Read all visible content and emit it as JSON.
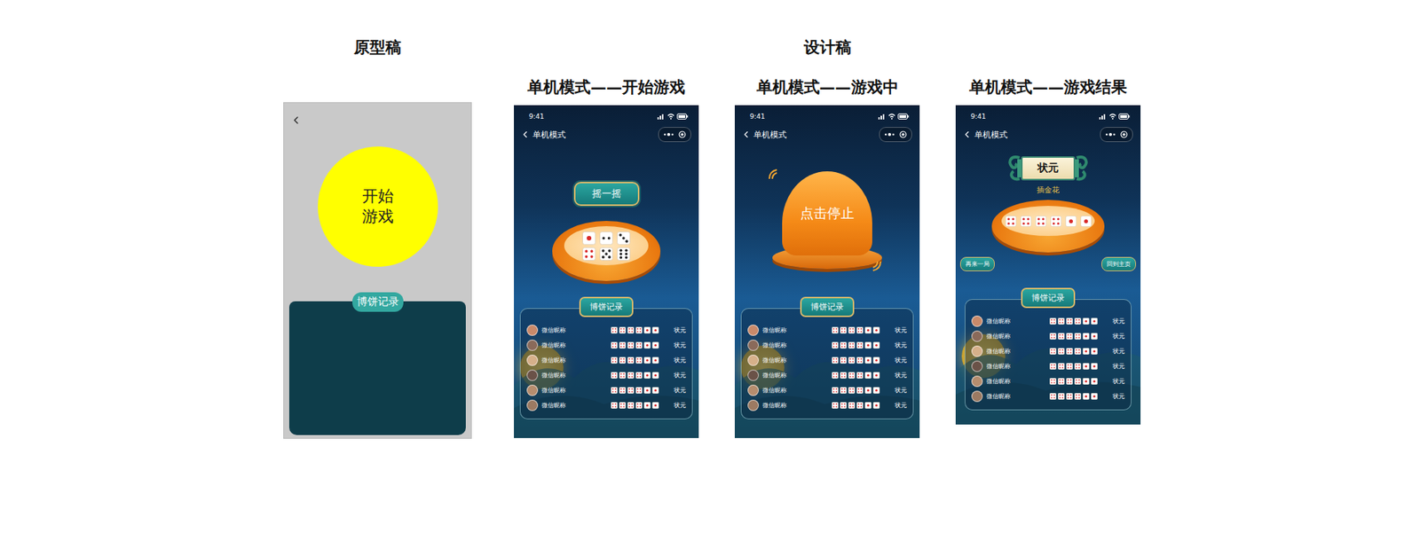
{
  "headings": {
    "prototype": "原型稿",
    "design": "设计稿"
  },
  "prototype": {
    "start_lines": [
      "开始",
      "游戏"
    ],
    "record_title": "博饼记录"
  },
  "screens": [
    {
      "kind": "start",
      "label": "单机模式——开始游戏",
      "time": "9:41",
      "nav_title": "单机模式",
      "badge": "摇一摇",
      "bowl_dice": [
        1,
        2,
        3,
        4,
        5,
        6
      ],
      "record_title": "博饼记录",
      "records": [
        {
          "name": "微信昵称",
          "dice": [
            4,
            4,
            4,
            4,
            1,
            1
          ],
          "result": "状元"
        },
        {
          "name": "微信昵称",
          "dice": [
            4,
            4,
            4,
            4,
            1,
            1
          ],
          "result": "状元"
        },
        {
          "name": "微信昵称",
          "dice": [
            4,
            4,
            4,
            4,
            1,
            1
          ],
          "result": "状元"
        },
        {
          "name": "微信昵称",
          "dice": [
            4,
            4,
            4,
            4,
            1,
            1
          ],
          "result": "状元"
        },
        {
          "name": "微信昵称",
          "dice": [
            4,
            4,
            4,
            4,
            1,
            1
          ],
          "result": "状元"
        },
        {
          "name": "微信昵称",
          "dice": [
            4,
            4,
            4,
            4,
            1,
            1
          ],
          "result": "状元"
        }
      ]
    },
    {
      "kind": "playing",
      "label": "单机模式——游戏中",
      "time": "9:41",
      "nav_title": "单机模式",
      "cup": "点击停止",
      "record_title": "博饼记录",
      "records": [
        {
          "name": "微信昵称",
          "dice": [
            4,
            4,
            4,
            4,
            1,
            1
          ],
          "result": "状元"
        },
        {
          "name": "微信昵称",
          "dice": [
            4,
            4,
            4,
            4,
            1,
            1
          ],
          "result": "状元"
        },
        {
          "name": "微信昵称",
          "dice": [
            4,
            4,
            4,
            4,
            1,
            1
          ],
          "result": "状元"
        },
        {
          "name": "微信昵称",
          "dice": [
            4,
            4,
            4,
            4,
            1,
            1
          ],
          "result": "状元"
        },
        {
          "name": "微信昵称",
          "dice": [
            4,
            4,
            4,
            4,
            1,
            1
          ],
          "result": "状元"
        },
        {
          "name": "微信昵称",
          "dice": [
            4,
            4,
            4,
            4,
            1,
            1
          ],
          "result": "状元"
        }
      ]
    },
    {
      "kind": "result",
      "label": "单机模式——游戏结果",
      "time": "9:41",
      "nav_title": "单机模式",
      "rank": "状元",
      "combo": "插金花",
      "bowl_dice": [
        4,
        4,
        4,
        4,
        1,
        1
      ],
      "actions": [
        "再来一局",
        "回到主页"
      ],
      "record_title": "博饼记录",
      "records": [
        {
          "name": "微信昵称",
          "dice": [
            4,
            4,
            4,
            4,
            1,
            1
          ],
          "result": "状元"
        },
        {
          "name": "微信昵称",
          "dice": [
            4,
            4,
            4,
            4,
            1,
            1
          ],
          "result": "状元"
        },
        {
          "name": "微信昵称",
          "dice": [
            4,
            4,
            4,
            4,
            1,
            1
          ],
          "result": "状元"
        },
        {
          "name": "微信昵称",
          "dice": [
            4,
            4,
            4,
            4,
            1,
            1
          ],
          "result": "状元"
        },
        {
          "name": "微信昵称",
          "dice": [
            4,
            4,
            4,
            4,
            1,
            1
          ],
          "result": "状元"
        },
        {
          "name": "微信昵称",
          "dice": [
            4,
            4,
            4,
            4,
            1,
            1
          ],
          "result": "状元"
        }
      ]
    }
  ]
}
